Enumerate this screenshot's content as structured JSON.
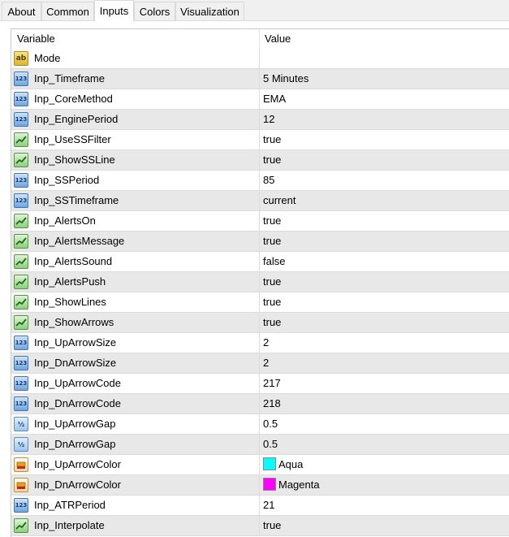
{
  "tabs": [
    {
      "label": "About"
    },
    {
      "label": "Common"
    },
    {
      "label": "Inputs"
    },
    {
      "label": "Colors"
    },
    {
      "label": "Visualization"
    }
  ],
  "active_tab": "Inputs",
  "header": {
    "variable": "Variable",
    "value": "Value"
  },
  "rows": [
    {
      "name": "Mode",
      "value": "",
      "type": "string"
    },
    {
      "name": "Inp_Timeframe",
      "value": "5 Minutes",
      "type": "int"
    },
    {
      "name": "Inp_CoreMethod",
      "value": "EMA",
      "type": "int"
    },
    {
      "name": "Inp_EnginePeriod",
      "value": "12",
      "type": "int"
    },
    {
      "name": "Inp_UseSSFilter",
      "value": "true",
      "type": "bool"
    },
    {
      "name": "Inp_ShowSSLine",
      "value": "true",
      "type": "bool"
    },
    {
      "name": "Inp_SSPeriod",
      "value": "85",
      "type": "int"
    },
    {
      "name": "Inp_SSTimeframe",
      "value": "current",
      "type": "int"
    },
    {
      "name": "Inp_AlertsOn",
      "value": "true",
      "type": "bool"
    },
    {
      "name": "Inp_AlertsMessage",
      "value": "true",
      "type": "bool"
    },
    {
      "name": "Inp_AlertsSound",
      "value": "false",
      "type": "bool"
    },
    {
      "name": "Inp_AlertsPush",
      "value": "true",
      "type": "bool"
    },
    {
      "name": "Inp_ShowLines",
      "value": "true",
      "type": "bool"
    },
    {
      "name": "Inp_ShowArrows",
      "value": "true",
      "type": "bool"
    },
    {
      "name": "Inp_UpArrowSize",
      "value": "2",
      "type": "int"
    },
    {
      "name": "Inp_DnArrowSize",
      "value": "2",
      "type": "int"
    },
    {
      "name": "Inp_UpArrowCode",
      "value": "217",
      "type": "int"
    },
    {
      "name": "Inp_DnArrowCode",
      "value": "218",
      "type": "int"
    },
    {
      "name": "Inp_UpArrowGap",
      "value": "0.5",
      "type": "double"
    },
    {
      "name": "Inp_DnArrowGap",
      "value": "0.5",
      "type": "double"
    },
    {
      "name": "Inp_UpArrowColor",
      "value": "Aqua",
      "type": "color",
      "color": "#00ffff"
    },
    {
      "name": "Inp_DnArrowColor",
      "value": "Magenta",
      "type": "color",
      "color": "#ff00ff"
    },
    {
      "name": "Inp_ATRPeriod",
      "value": "21",
      "type": "int"
    },
    {
      "name": "Inp_Interpolate",
      "value": "true",
      "type": "bool"
    }
  ],
  "icon_names": {
    "string": "string-type-icon",
    "int": "integer-type-icon",
    "bool": "boolean-type-icon",
    "double": "double-type-icon",
    "color": "color-type-icon"
  },
  "icon_glyphs": {
    "string": "ab",
    "int": "123",
    "double": "½"
  }
}
